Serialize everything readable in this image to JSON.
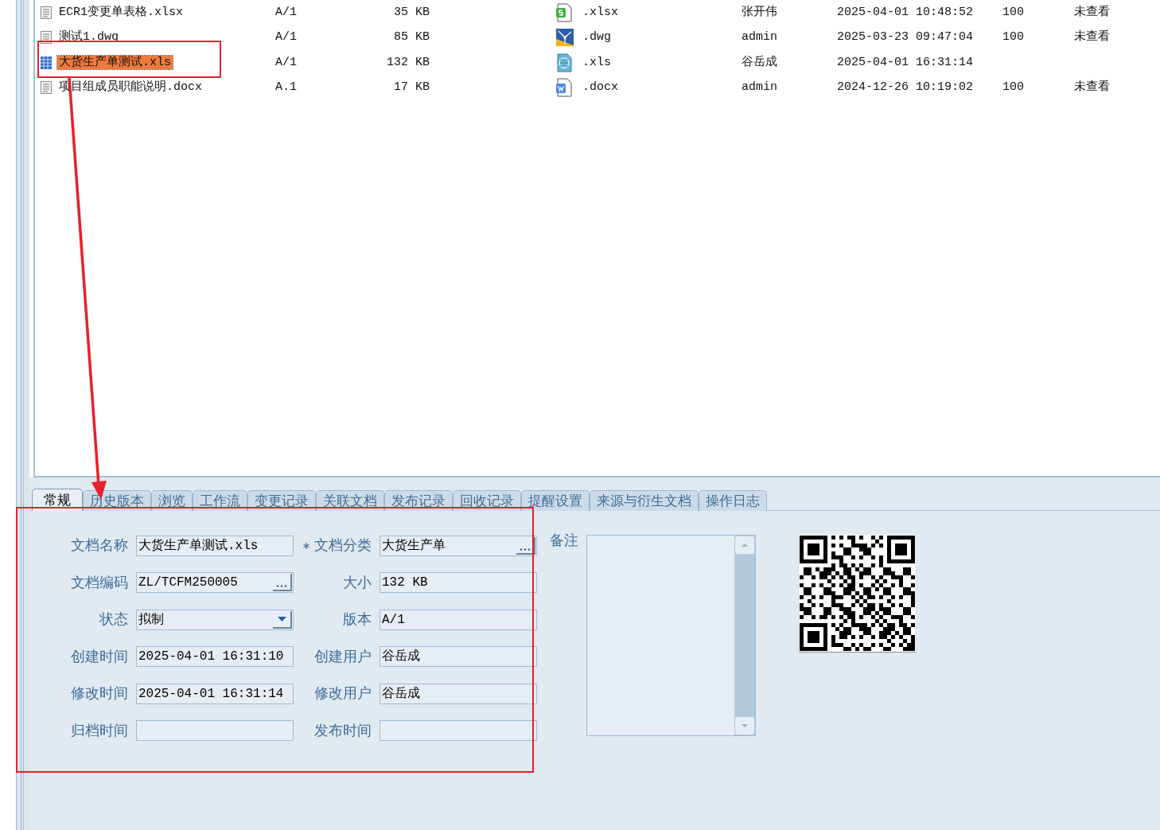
{
  "files": [
    {
      "name": "ECR1变更单表格.xlsx",
      "selected": false,
      "version": "A/1",
      "size": "35 KB",
      "kind": "sheet",
      "ext": ".xlsx",
      "user": "张开伟",
      "time": "2025-04-01 10:48:52",
      "count": "100",
      "status": "未查看"
    },
    {
      "name": "测试1.dwg",
      "selected": false,
      "version": "A/1",
      "size": "85 KB",
      "kind": "cad",
      "ext": ".dwg",
      "user": "admin",
      "time": "2025-03-23 09:47:04",
      "count": "100",
      "status": "未查看"
    },
    {
      "name": "大货生产单测试.xls",
      "selected": true,
      "version": "A/1",
      "size": "132 KB",
      "kind": "xls",
      "ext": ".xls",
      "user": "谷岳成",
      "time": "2025-04-01 16:31:14"
    },
    {
      "name": "项目组成员职能说明.docx",
      "selected": false,
      "version": "A.1",
      "size": "17 KB",
      "kind": "word",
      "ext": ".docx",
      "user": "admin",
      "time": "2024-12-26 10:19:02",
      "count": "100",
      "status": "未查看"
    }
  ],
  "tabs": [
    {
      "label": "常规",
      "selected": true
    },
    {
      "label": "历史版本",
      "selected": false
    },
    {
      "label": "浏览",
      "selected": false
    },
    {
      "label": "工作流",
      "selected": false
    },
    {
      "label": "变更记录",
      "selected": false
    },
    {
      "label": "关联文档",
      "selected": false
    },
    {
      "label": "发布记录",
      "selected": false
    },
    {
      "label": "回收记录",
      "selected": false
    },
    {
      "label": "提醒设置",
      "selected": false
    },
    {
      "label": "来源与衍生文档",
      "selected": false
    },
    {
      "label": "操作日志",
      "selected": false
    }
  ],
  "form_rows": [
    [
      {
        "label": "文档名称",
        "kind": "text",
        "value": "大货生产单测试.xls"
      },
      {
        "label": "文档分类",
        "kind": "lookup",
        "required": true,
        "value": "大货生产单"
      }
    ],
    [
      {
        "label": "文档编码",
        "kind": "lookup",
        "value": "ZL/TCFM250005"
      },
      {
        "label": "大小",
        "kind": "text",
        "value": "132 KB"
      }
    ],
    [
      {
        "label": "状态",
        "kind": "select",
        "value": "拟制"
      },
      {
        "label": "版本",
        "kind": "text",
        "value": "A/1"
      }
    ],
    [
      {
        "label": "创建时间",
        "kind": "text",
        "value": "2025-04-01 16:31:10"
      },
      {
        "label": "创建用户",
        "kind": "text",
        "value": "谷岳成"
      }
    ],
    [
      {
        "label": "修改时间",
        "kind": "text",
        "value": "2025-04-01 16:31:14"
      },
      {
        "label": "修改用户",
        "kind": "text",
        "value": "谷岳成"
      }
    ],
    [
      {
        "label": "归档时间",
        "kind": "text"
      },
      {
        "label": "发布时间",
        "kind": "text"
      }
    ]
  ],
  "memo": {
    "label": "备注"
  }
}
